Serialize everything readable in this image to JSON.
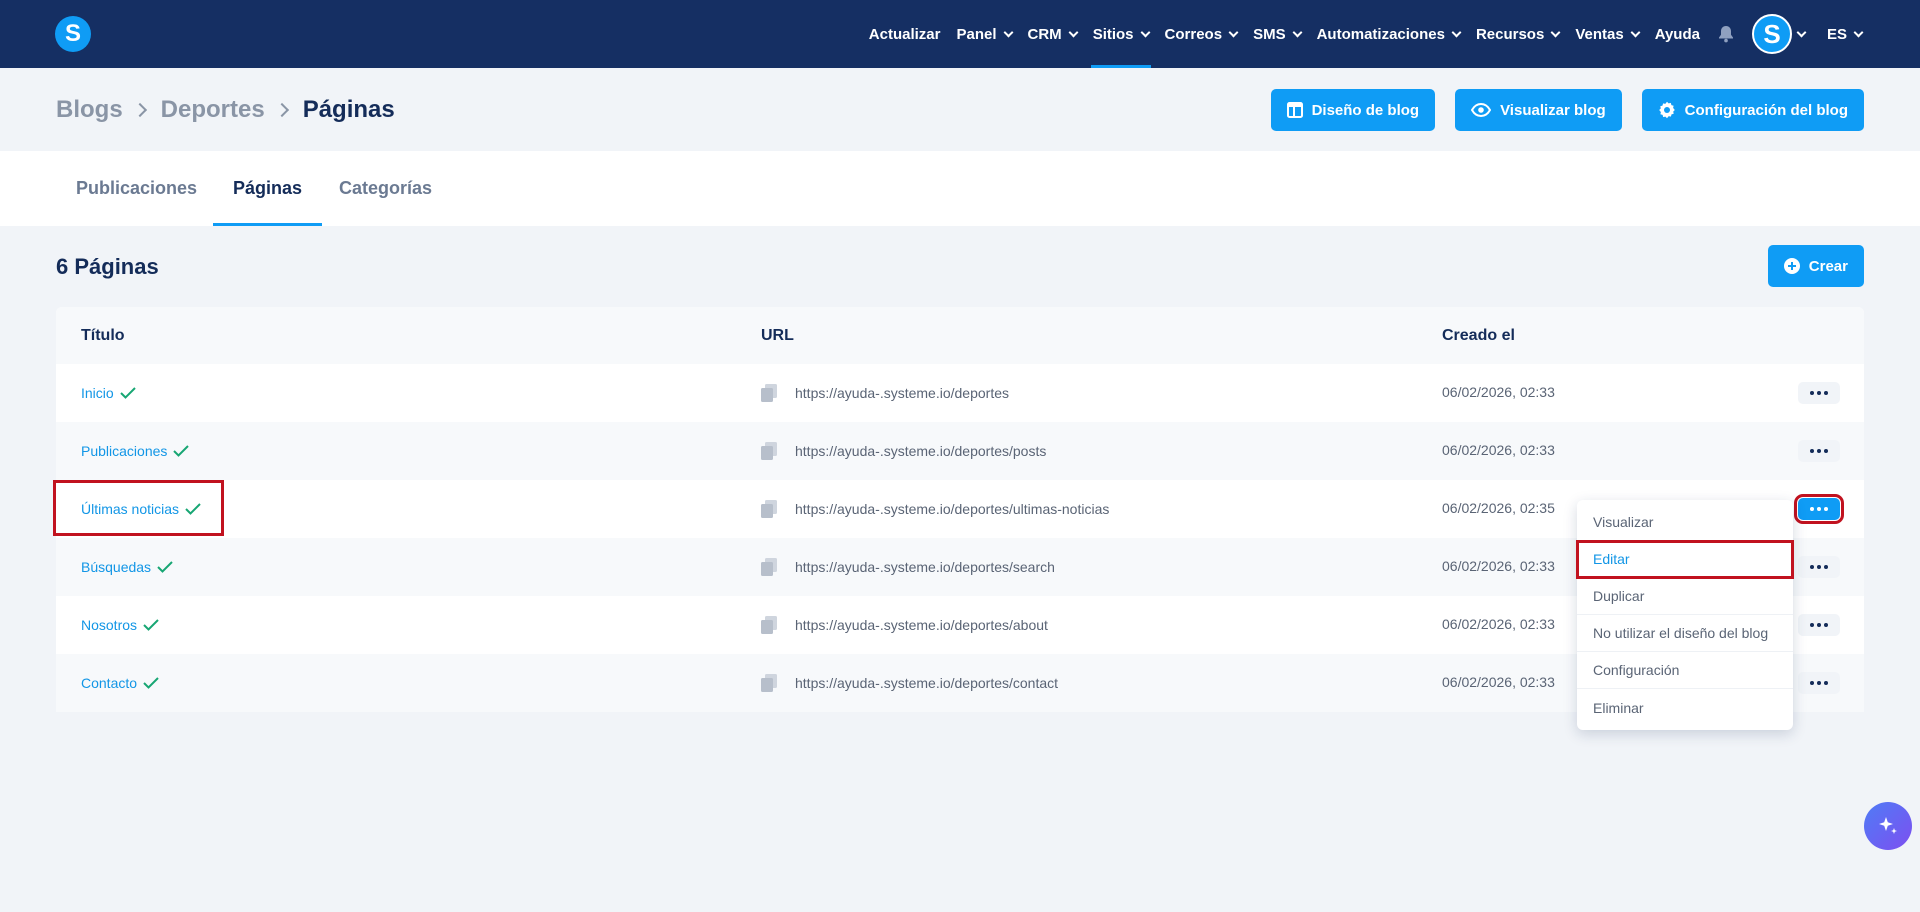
{
  "app": {
    "logo_letter": "S",
    "brand_color": "#0f9cf5",
    "nav_color": "#152f63"
  },
  "nav": {
    "items": [
      {
        "label": "Actualizar",
        "has_chevron": false
      },
      {
        "label": "Panel",
        "has_chevron": true
      },
      {
        "label": "CRM",
        "has_chevron": true
      },
      {
        "label": "Sitios",
        "has_chevron": true,
        "active": true
      },
      {
        "label": "Correos",
        "has_chevron": true
      },
      {
        "label": "SMS",
        "has_chevron": true
      },
      {
        "label": "Automatizaciones",
        "has_chevron": true
      },
      {
        "label": "Recursos",
        "has_chevron": true
      },
      {
        "label": "Ventas",
        "has_chevron": true
      },
      {
        "label": "Ayuda",
        "has_chevron": false
      }
    ],
    "avatar_letter": "S",
    "language": "ES"
  },
  "breadcrumb": [
    "Blogs",
    "Deportes",
    "Páginas"
  ],
  "header_buttons": {
    "design": "Diseño de blog",
    "view": "Visualizar blog",
    "config": "Configuración del blog"
  },
  "tabs": [
    "Publicaciones",
    "Páginas",
    "Categorías"
  ],
  "active_tab": "Páginas",
  "page_count": "6 Páginas",
  "create_label": "Crear",
  "table": {
    "headers": {
      "title": "Título",
      "url": "URL",
      "created": "Creado el"
    },
    "rows": [
      {
        "title": "Inicio",
        "url": "https://ayuda-.systeme.io/deportes",
        "created": "06/02/2026, 02:33"
      },
      {
        "title": "Publicaciones",
        "url": "https://ayuda-.systeme.io/deportes/posts",
        "created": "06/02/2026, 02:33"
      },
      {
        "title": "Últimas noticias",
        "url": "https://ayuda-.systeme.io/deportes/ultimas-noticias",
        "created": "06/02/2026, 02:35"
      },
      {
        "title": "Búsquedas",
        "url": "https://ayuda-.systeme.io/deportes/search",
        "created": "06/02/2026, 02:33"
      },
      {
        "title": "Nosotros",
        "url": "https://ayuda-.systeme.io/deportes/about",
        "created": "06/02/2026, 02:33"
      },
      {
        "title": "Contacto",
        "url": "https://ayuda-.systeme.io/deportes/contact",
        "created": "06/02/2026, 02:33"
      }
    ]
  },
  "dropdown": {
    "items": [
      "Visualizar",
      "Editar",
      "Duplicar",
      "No utilizar el diseño del blog",
      "Configuración",
      "Eliminar"
    ],
    "selected": "Editar"
  }
}
